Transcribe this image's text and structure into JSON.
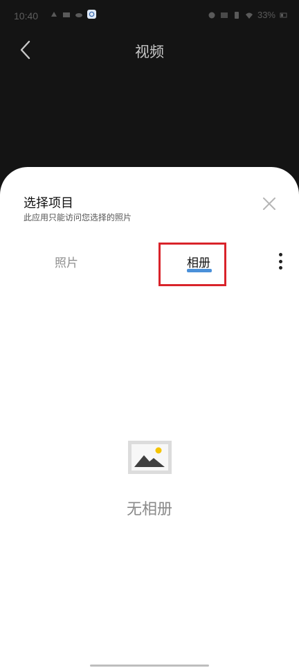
{
  "status_bar": {
    "time": "10:40",
    "battery": "33%"
  },
  "app_bar": {
    "title": "视频"
  },
  "sheet": {
    "title": "选择项目",
    "subtitle": "此应用只能访问您选择的照片",
    "tabs": [
      {
        "label": "照片",
        "selected": false
      },
      {
        "label": "相册",
        "selected": true
      }
    ],
    "empty_state": {
      "text": "无相册"
    }
  },
  "colors": {
    "tab_indicator": "#4a90d9",
    "highlight_box": "#d9232a",
    "image_sun": "#f5c400"
  }
}
